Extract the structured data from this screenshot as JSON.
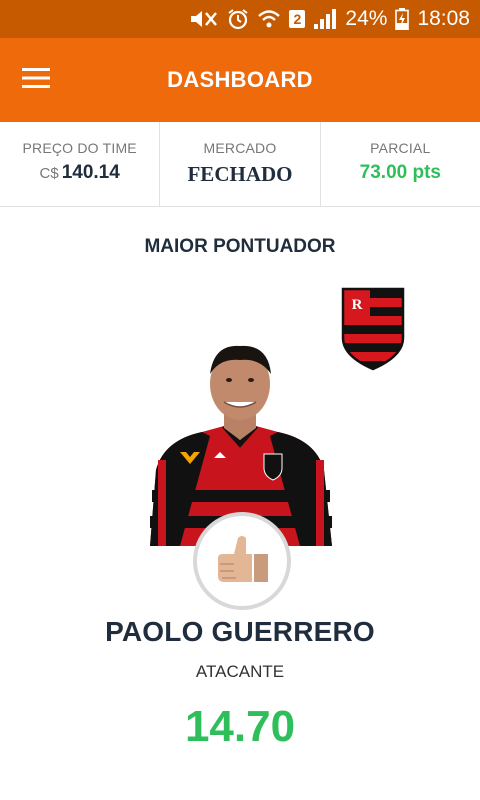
{
  "status_bar": {
    "battery": "24%",
    "time": "18:08",
    "sim_slot": "2",
    "icons": [
      "mute-vibrate-icon",
      "alarm-icon",
      "wifi-icon",
      "signal-icon",
      "battery-charging-icon"
    ]
  },
  "app_bar": {
    "title": "DASHBOARD",
    "menu_icon": "hamburger-menu-icon"
  },
  "stats": {
    "preco": {
      "label": "PREÇO DO TIME",
      "currency": "C$",
      "value": "140.14"
    },
    "mercado": {
      "label": "MERCADO",
      "value": "FECHADO"
    },
    "parcial": {
      "label": "PARCIAL",
      "value": "73.00 pts"
    }
  },
  "top_scorer": {
    "section_title": "MAIOR PONTUADOR",
    "club_icon": "club-shield-icon",
    "player_name": "PAOLO GUERRERO",
    "position": "ATACANTE",
    "score": "14.70",
    "thumb_icon": "thumbs-up-icon"
  },
  "colors": {
    "status_bar": "#c55a00",
    "app_bar": "#ef6a0a",
    "accent_green": "#2fbf5a",
    "dark_text": "#1f2d3d"
  }
}
